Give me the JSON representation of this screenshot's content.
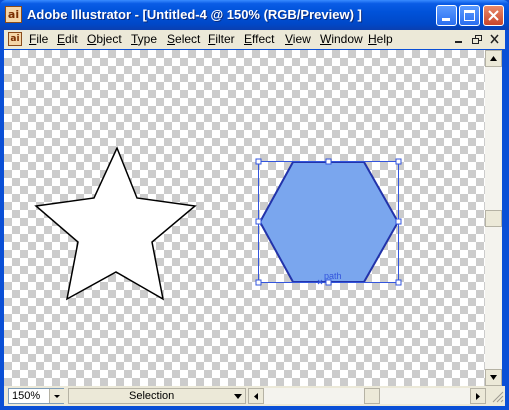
{
  "window": {
    "title": "Adobe Illustrator - [Untitled-4 @ 150% (RGB/Preview) ]",
    "app_icon_glyph": "ai"
  },
  "menubar": {
    "items": [
      "File",
      "Edit",
      "Object",
      "Type",
      "Select",
      "Filter",
      "Effect",
      "View",
      "Window",
      "Help"
    ]
  },
  "canvas": {
    "star": {
      "fill": "#ffffff",
      "stroke": "#000000"
    },
    "hexagon": {
      "fill": "#7aa6ee",
      "stroke": "#2233aa",
      "selected": true
    },
    "selection_color": "#3355dd",
    "smart_guide_label": "path"
  },
  "statusbar": {
    "zoom": "150%",
    "tool": "Selection"
  },
  "icons": {
    "minimize": "minimize-icon",
    "maximize": "maximize-icon",
    "close": "close-icon"
  }
}
